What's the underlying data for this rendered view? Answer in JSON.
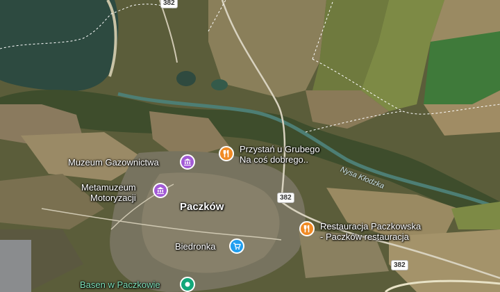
{
  "map": {
    "town_label": "Paczków",
    "river_label": "Nysa Kłodzka",
    "road_shields": [
      "382",
      "382",
      "382"
    ],
    "pois": [
      {
        "name": "Przystań u Grubego\nNa coś dobrego..",
        "type": "restaurant",
        "color": "#f08a24"
      },
      {
        "name": "Muzeum Gazownictwa",
        "type": "museum",
        "color": "#a35bd6"
      },
      {
        "name": "Metamuzeum\nMotoryzacji",
        "type": "museum",
        "color": "#a35bd6"
      },
      {
        "name": "Restauracja Paczkowska\n- Paczków restauracja",
        "type": "restaurant",
        "color": "#f08a24"
      },
      {
        "name": "Biedronka",
        "type": "shop",
        "color": "#1f9ef0"
      },
      {
        "name": "Basen w Paczkowie",
        "type": "leisure",
        "color": "#12a77a"
      }
    ]
  }
}
